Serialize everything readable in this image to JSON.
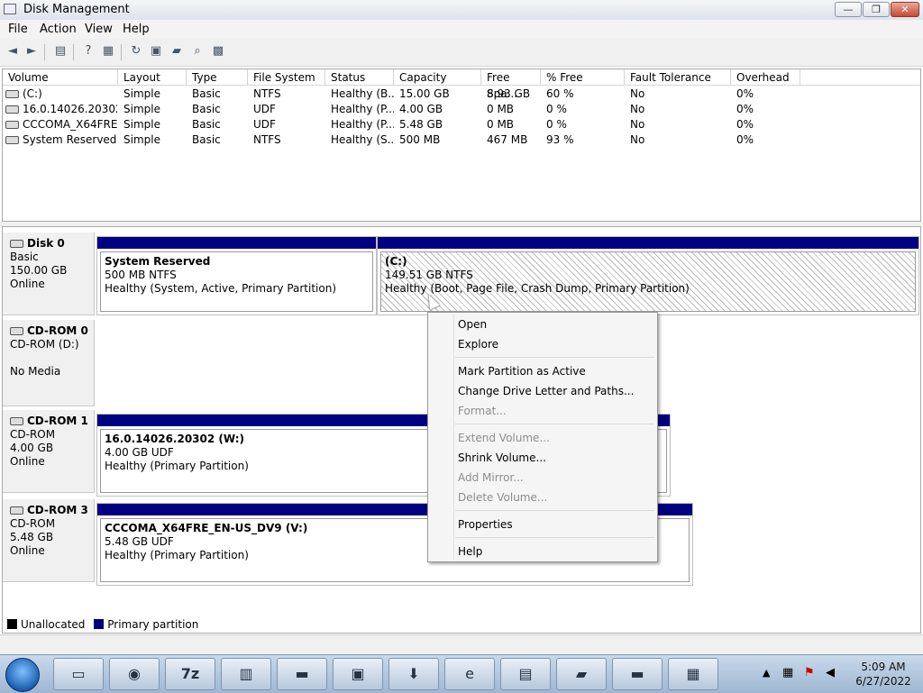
{
  "window": {
    "title": "Disk Management",
    "minimize": "—",
    "maximize": "❐",
    "close": "✕"
  },
  "menu": [
    "File",
    "Action",
    "View",
    "Help"
  ],
  "toolbar": {
    "icons": [
      "back-icon",
      "forward-icon",
      "show-hide-tree-icon",
      "help-icon",
      "properties-icon",
      "refresh-icon",
      "rescan-disks-icon",
      "open-icon",
      "explore-icon",
      "settings-icon"
    ]
  },
  "volumes": {
    "columns": [
      "Volume",
      "Layout",
      "Type",
      "File System",
      "Status",
      "Capacity",
      "Free Spa...",
      "% Free",
      "Fault Tolerance",
      "Overhead"
    ],
    "rows": [
      [
        "(C:)",
        "Simple",
        "Basic",
        "NTFS",
        "Healthy (B...",
        "15.00 GB",
        "8.93 GB",
        "60 %",
        "No",
        "0%"
      ],
      [
        "16.0.14026.20302 (...",
        "Simple",
        "Basic",
        "UDF",
        "Healthy (P...",
        "4.00 GB",
        "0 MB",
        "0 %",
        "No",
        "0%"
      ],
      [
        "CCCOMA_X64FRE...",
        "Simple",
        "Basic",
        "UDF",
        "Healthy (P...",
        "5.48 GB",
        "0 MB",
        "0 %",
        "No",
        "0%"
      ],
      [
        "System Reserved",
        "Simple",
        "Basic",
        "NTFS",
        "Healthy (S...",
        "500 MB",
        "467 MB",
        "93 %",
        "No",
        "0%"
      ]
    ]
  },
  "disks": [
    {
      "name": "Disk 0",
      "lines": [
        "Basic",
        "150.00 GB",
        "Online"
      ],
      "partitions": [
        {
          "title": "System Reserved",
          "size": "500 MB NTFS",
          "status": "Healthy (System, Active, Primary Partition)"
        },
        {
          "title": "(C:)",
          "size": "149.51 GB NTFS",
          "status": "Healthy (Boot, Page File, Crash Dump, Primary Partition)"
        }
      ]
    },
    {
      "name": "CD-ROM 0",
      "lines": [
        "CD-ROM (D:)",
        "",
        "No Media"
      ],
      "partitions": []
    },
    {
      "name": "CD-ROM 1",
      "lines": [
        "CD-ROM",
        "4.00 GB",
        "Online"
      ],
      "partitions": [
        {
          "title": "16.0.14026.20302  (W:)",
          "size": "4.00 GB UDF",
          "status": "Healthy (Primary Partition)"
        }
      ]
    },
    {
      "name": "CD-ROM 3",
      "lines": [
        "CD-ROM",
        "5.48 GB",
        "Online"
      ],
      "partitions": [
        {
          "title": "CCCOMA_X64FRE_EN-US_DV9  (V:)",
          "size": "5.48 GB UDF",
          "status": "Healthy (Primary Partition)"
        }
      ]
    }
  ],
  "legend": {
    "unallocated": "Unallocated",
    "primary": "Primary partition",
    "unallocated_color": "#000000",
    "primary_color": "#000080"
  },
  "context_menu": {
    "items": [
      {
        "label": "Open",
        "enabled": true
      },
      {
        "label": "Explore",
        "enabled": true
      },
      {
        "label": "Mark Partition as Active",
        "enabled": true
      },
      {
        "label": "Change Drive Letter and Paths...",
        "enabled": true
      },
      {
        "label": "Format...",
        "enabled": false
      },
      {
        "label": "Extend Volume...",
        "enabled": false
      },
      {
        "label": "Shrink Volume...",
        "enabled": true
      },
      {
        "label": "Add Mirror...",
        "enabled": false
      },
      {
        "label": "Delete Volume...",
        "enabled": false
      },
      {
        "label": "Properties",
        "enabled": true
      },
      {
        "label": "Help",
        "enabled": true
      }
    ]
  },
  "taskbar": {
    "apps": [
      "explorer-icon",
      "disk-utility-icon",
      "7zip-icon",
      "setup-icon",
      "command-prompt-icon",
      "remote-desktop-icon",
      "download-icon",
      "internet-explorer-icon",
      "disk-management-icon",
      "toolbox-icon",
      "command-prompt-icon",
      "drive-icon"
    ],
    "clock": {
      "time": "5:09 AM",
      "date": "6/27/2022"
    }
  }
}
